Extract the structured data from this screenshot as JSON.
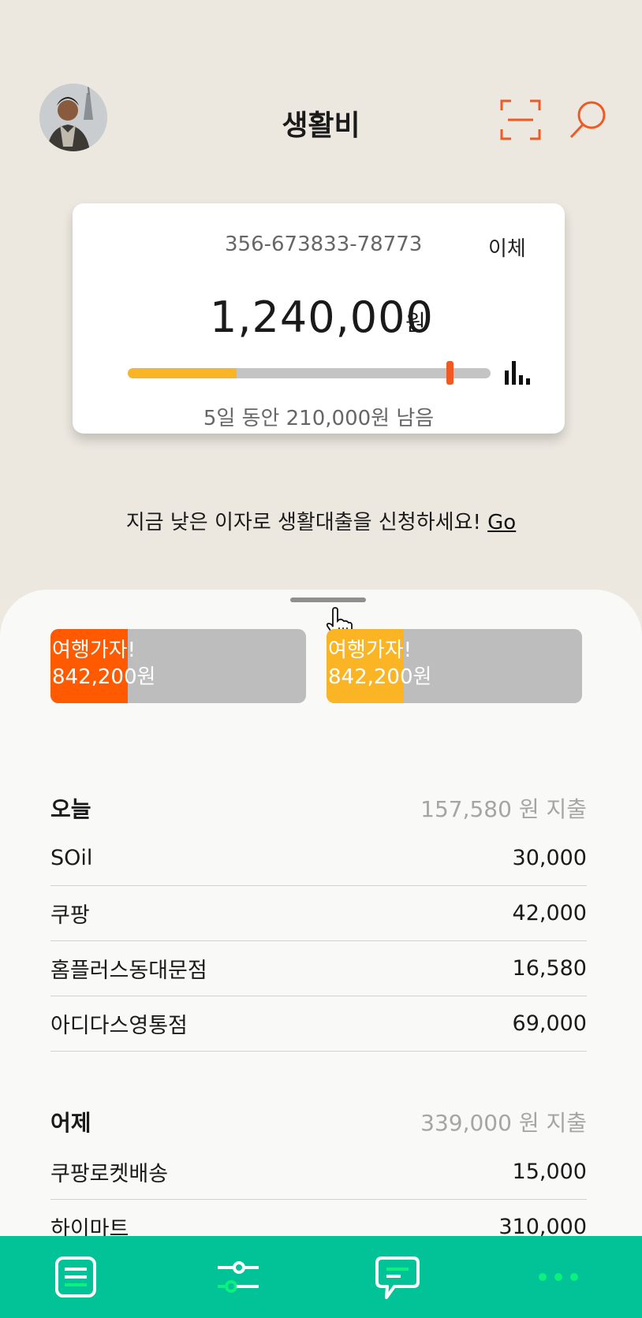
{
  "header": {
    "title": "생활비",
    "icons": {
      "avatar": "profile-photo",
      "scan": "scan-icon",
      "search": "search-icon"
    }
  },
  "account_card": {
    "account_number": "356-673833-78773",
    "transfer_label": "이체",
    "balance": "1,240,000",
    "currency": "원",
    "spent_fraction": 0.3,
    "remaining_text": "5일 동안 210,000원 남음"
  },
  "promo": {
    "text": "지금 낮은 이자로 생활대출을 신청하세요!",
    "link_label": "Go"
  },
  "goals": [
    {
      "title": "여행가자!",
      "amount": "842,200원",
      "color": "#ff5a00"
    },
    {
      "title": "여행가자!",
      "amount": "842,200원",
      "color": "#fbb424"
    }
  ],
  "days": [
    {
      "label": "오늘",
      "total": "157,580 원 지출",
      "items": [
        {
          "name": "SOil",
          "amount": "30,000"
        },
        {
          "name": "쿠팡",
          "amount": "42,000"
        },
        {
          "name": "홈플러스동대문점",
          "amount": "16,580"
        },
        {
          "name": "아디다스영통점",
          "amount": "69,000"
        }
      ]
    },
    {
      "label": "어제",
      "total": "339,000 원 지출",
      "items": [
        {
          "name": "쿠팡로켓배송",
          "amount": "15,000"
        },
        {
          "name": "하이마트",
          "amount": "310,000"
        }
      ]
    }
  ],
  "tabbar": {
    "icons": [
      "list-icon",
      "filter-icon",
      "chat-icon",
      "more-icon"
    ],
    "color": "#02c397"
  }
}
